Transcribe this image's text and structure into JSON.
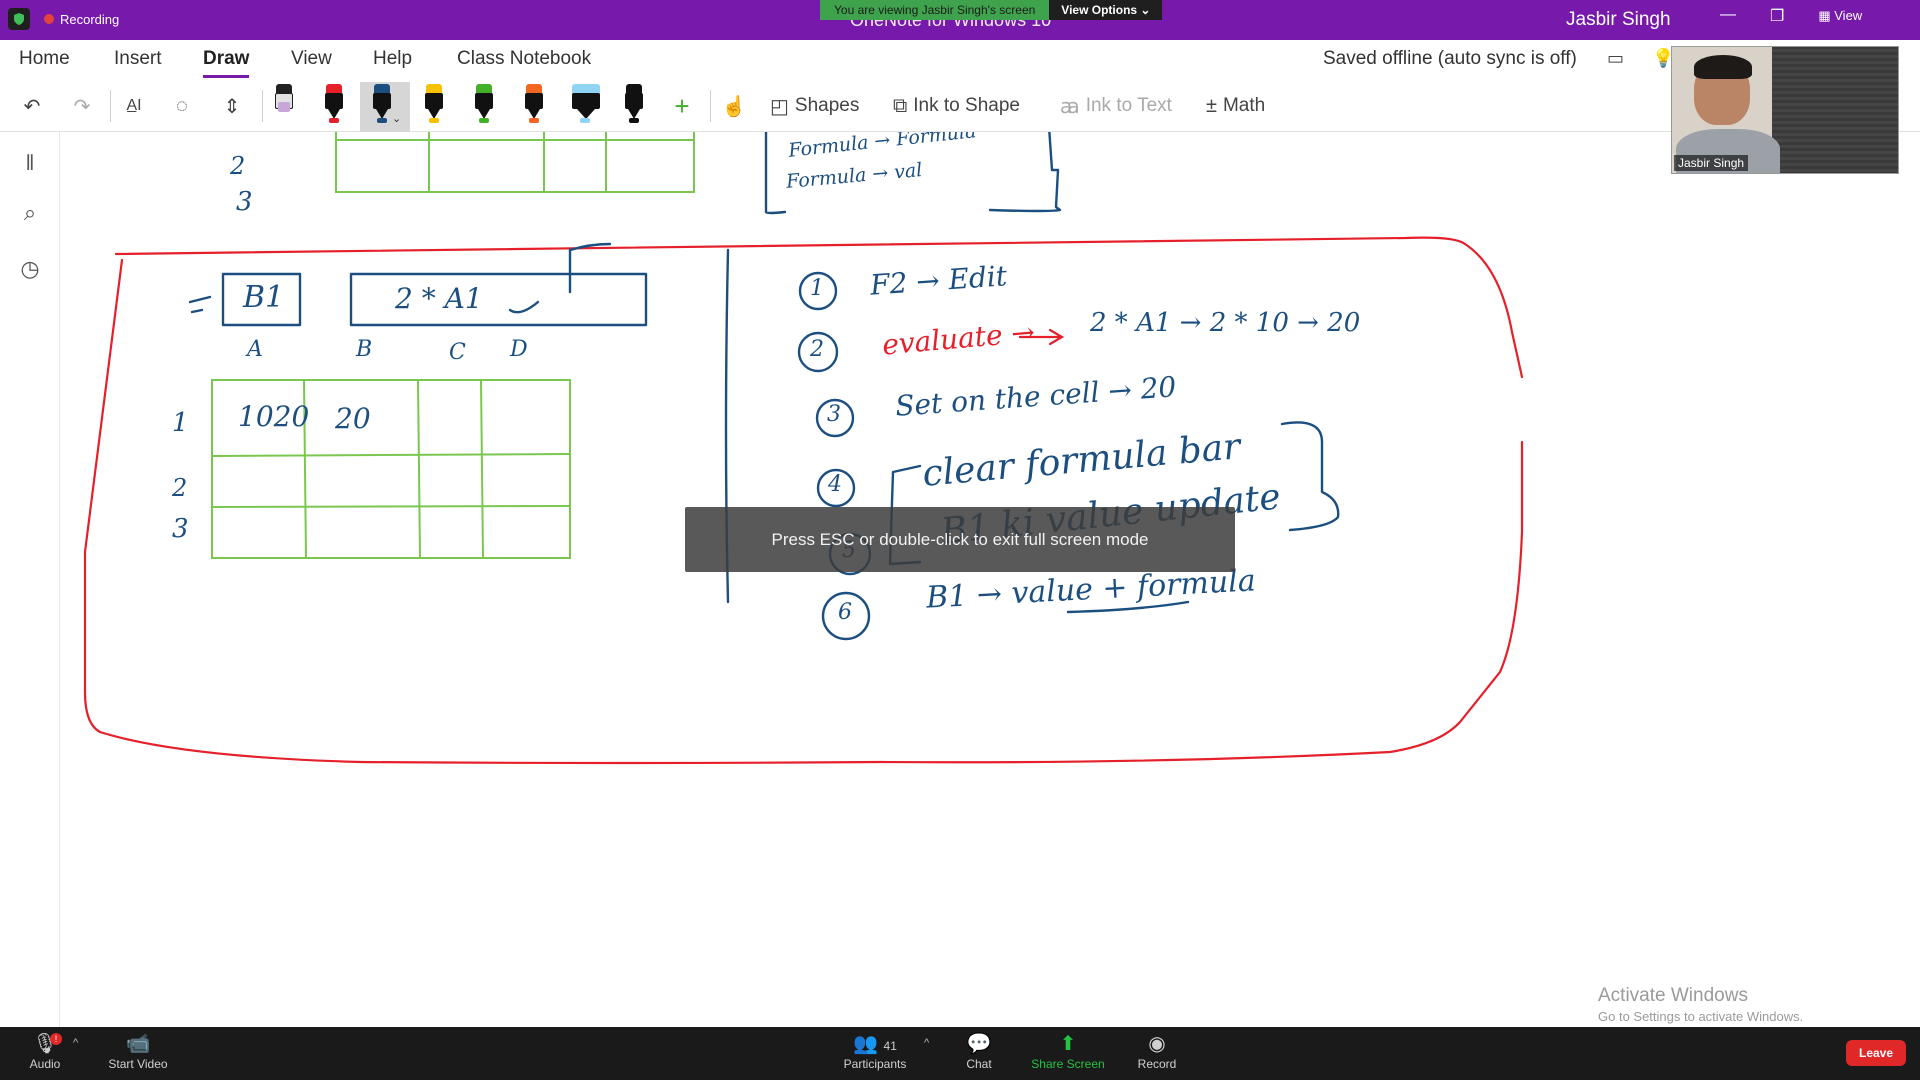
{
  "titlebar": {
    "recording_label": "Recording",
    "app_title": "OneNote for Windows 10",
    "viewing_text": "You are viewing Jasbir Singh's screen",
    "view_options_label": "View Options",
    "user_name": "Jasbir Singh",
    "view_label": "View"
  },
  "ribbon": {
    "tabs": [
      "Home",
      "Insert",
      "Draw",
      "View",
      "Help",
      "Class Notebook"
    ],
    "active_tab": "Draw",
    "sync_status": "Saved offline (auto sync is off)",
    "tools": {
      "shapes_label": "Shapes",
      "ink_to_shape_label": "Ink to Shape",
      "ink_to_text_label": "Ink to Text",
      "math_label": "Math"
    },
    "pens": [
      {
        "name": "highlighter-pen-pink",
        "color": "#c9a6d9"
      },
      {
        "name": "pen-red",
        "color": "#e5202a"
      },
      {
        "name": "pen-blue",
        "color": "#1c4f80"
      },
      {
        "name": "pen-yellow",
        "color": "#f6c200"
      },
      {
        "name": "pen-green",
        "color": "#43b02a"
      },
      {
        "name": "pen-orange",
        "color": "#f26522"
      },
      {
        "name": "highlighter-blue",
        "color": "#8fd3f5"
      },
      {
        "name": "pen-black",
        "color": "#111111"
      }
    ]
  },
  "canvas": {
    "top_table": {
      "row_labels": [
        "2",
        "3"
      ]
    },
    "top_notes": [
      "Formula → Formula",
      "Formula → val"
    ],
    "formula_bar": {
      "cell_ref": "B1",
      "formula": "2 * A1"
    },
    "columns": [
      "A",
      "B",
      "C",
      "D"
    ],
    "grid_rows": [
      "1",
      "2",
      "3"
    ],
    "cells": {
      "a1": "1020",
      "b1": "20"
    },
    "steps": [
      {
        "num": "1",
        "text": "F2 → Edit"
      },
      {
        "num": "2",
        "text": "evaluate →",
        "tail": "2 * A1 → 2 * 10 → 20"
      },
      {
        "num": "3",
        "text": "Set on the cell → 20"
      },
      {
        "num": "4",
        "text": "clear formula bar"
      },
      {
        "num": "5",
        "text": "B1 ki value update"
      },
      {
        "num": "6",
        "text": "B1 → value + formula"
      }
    ]
  },
  "overlay": {
    "esc_message": "Press ESC or double-click to exit full screen mode"
  },
  "video": {
    "participant_name": "Jasbir Singh"
  },
  "watermark": {
    "line1": "Activate Windows",
    "line2": "Go to Settings to activate Windows."
  },
  "zoombar": {
    "audio_label": "Audio",
    "start_video_label": "Start Video",
    "participants_label": "Participants",
    "participants_count": "41",
    "chat_label": "Chat",
    "share_screen_label": "Share Screen",
    "record_label": "Record",
    "leave_label": "Leave",
    "audio_badge": "!"
  }
}
